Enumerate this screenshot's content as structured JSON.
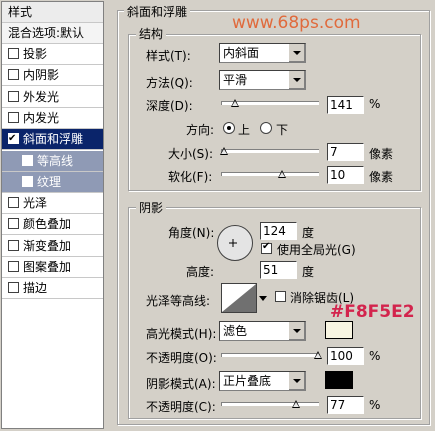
{
  "left_panel": {
    "header": "样式",
    "blending": "混合选项:默认",
    "items": [
      {
        "label": "投影",
        "checked": false
      },
      {
        "label": "内阴影",
        "checked": false
      },
      {
        "label": "外发光",
        "checked": false
      },
      {
        "label": "内发光",
        "checked": false
      },
      {
        "label": "斜面和浮雕",
        "checked": true
      },
      {
        "label": "等高线",
        "checked": false
      },
      {
        "label": "纹理",
        "checked": false
      },
      {
        "label": "光泽",
        "checked": false
      },
      {
        "label": "颜色叠加",
        "checked": false
      },
      {
        "label": "渐变叠加",
        "checked": false
      },
      {
        "label": "图案叠加",
        "checked": false
      },
      {
        "label": "描边",
        "checked": false
      }
    ]
  },
  "bevel": {
    "title": "斜面和浮雕",
    "watermark": "www.68ps.com",
    "structure": {
      "title": "结构",
      "style_label": "样式(T):",
      "style_value": "内斜面",
      "technique_label": "方法(Q):",
      "technique_value": "平滑",
      "depth_label": "深度(D):",
      "depth_value": "141",
      "depth_unit": "%",
      "depth_level": 0.14,
      "direction_label": "方向:",
      "direction_up": "上",
      "direction_down": "下",
      "size_label": "大小(S):",
      "size_value": "7",
      "size_unit": "像素",
      "size_level": 0.03,
      "soften_label": "软化(F):",
      "soften_value": "10",
      "soften_unit": "像素",
      "soften_level": 0.63
    },
    "shading": {
      "title": "阴影",
      "angle_label": "角度(N):",
      "angle_value": "124",
      "angle_unit": "度",
      "global_light_label": "使用全局光(G)",
      "global_light_checked": true,
      "altitude_label": "高度:",
      "altitude_value": "51",
      "altitude_unit": "度",
      "gloss_label": "光泽等高线:",
      "antialias_label": "消除锯齿(L)",
      "antialias_checked": false,
      "highlight_mode_label": "高光模式(H):",
      "highlight_mode_value": "滤色",
      "highlight_color": "#F8F5E2",
      "highlight_color_text": "#F8F5E2",
      "highlight_opacity_label": "不透明度(O):",
      "highlight_opacity_value": "100",
      "highlight_opacity_unit": "%",
      "highlight_opacity_level": 1.0,
      "shadow_mode_label": "阴影模式(A):",
      "shadow_mode_value": "正片叠底",
      "shadow_color": "#000000",
      "shadow_opacity_label": "不透明度(C):",
      "shadow_opacity_value": "77",
      "shadow_opacity_unit": "%",
      "shadow_opacity_level": 0.77
    }
  }
}
